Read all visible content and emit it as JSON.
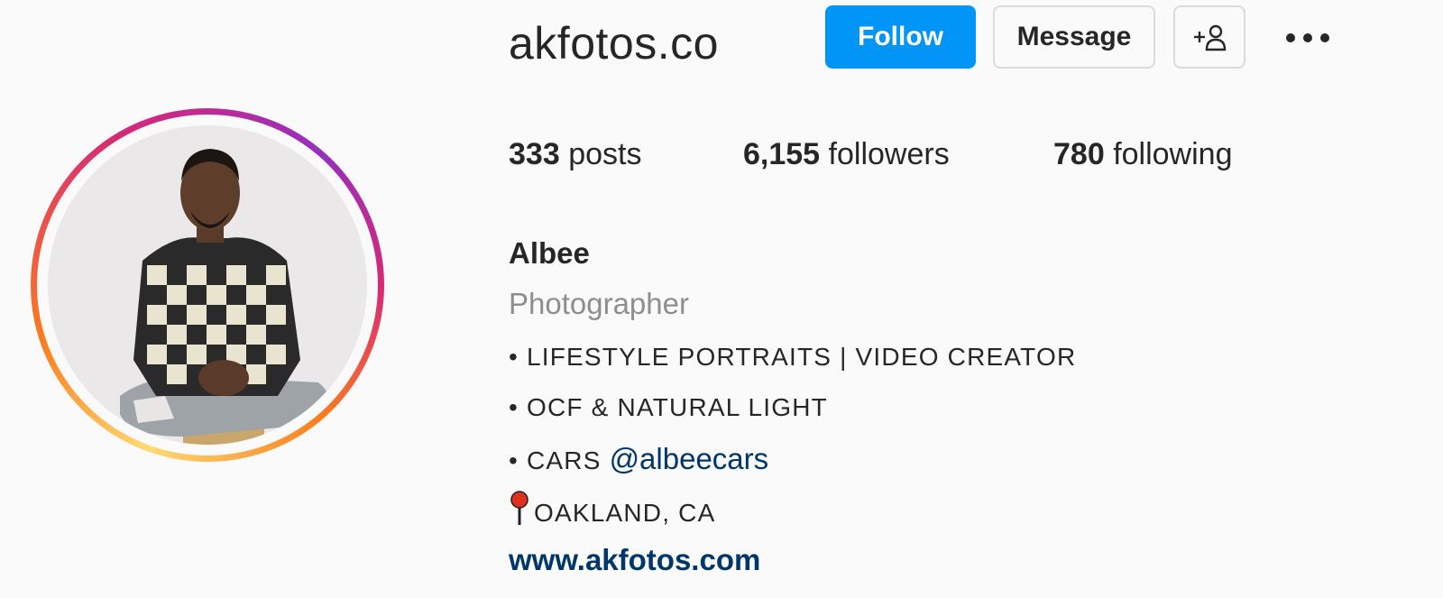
{
  "profile": {
    "username": "akfotos.co",
    "follow_label": "Follow",
    "message_label": "Message",
    "stats": {
      "posts_count": "333",
      "posts_label": "posts",
      "followers_count": "6,155",
      "followers_label": "followers",
      "following_count": "780",
      "following_label": "following"
    },
    "full_name": "Albee",
    "category": "Photographer",
    "bio": {
      "line1": "• LIFESTYLE PORTRAITS | VIDEO CREATOR",
      "line2": "• OCF & NATURAL LIGHT",
      "line3_prefix": "• CARS",
      "line3_mention": "@albeecars",
      "line4": "OAKLAND, CA"
    },
    "website": "www.akfotos.com"
  },
  "icons": {
    "suggest": "add-person-icon",
    "more": "more-options-icon",
    "pin": "round-pushpin-icon"
  },
  "colors": {
    "primary_button": "#0095f6",
    "link": "#00376b",
    "muted_text": "#8e8e8e"
  }
}
